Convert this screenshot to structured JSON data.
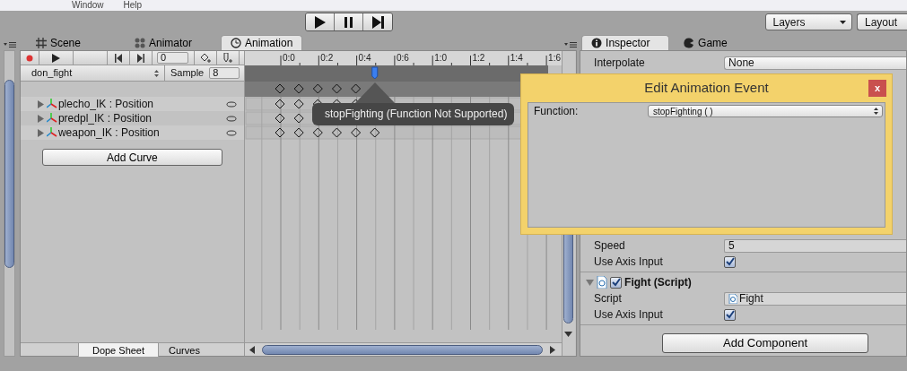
{
  "menu": [
    {
      "label": "Window"
    },
    {
      "label": "Help"
    }
  ],
  "toolbar": {
    "layers": "Layers",
    "layout": "Layout"
  },
  "left_tabs": [
    {
      "label": "Scene",
      "selected": false
    },
    {
      "label": "Animator",
      "selected": false
    },
    {
      "label": "Animation",
      "selected": true
    }
  ],
  "animation": {
    "recording": false,
    "frame": "0",
    "clip": "don_fight",
    "sample_label": "Sample",
    "sample": "8",
    "ruler": [
      "0:0",
      "0:2",
      "0:4",
      "0:6",
      "1:0",
      "1:2",
      "1:4",
      "1:6"
    ],
    "tracks": [
      {
        "name": "plecho_IK : Position",
        "expanded": false
      },
      {
        "name": "predpl_IK : Position",
        "expanded": false
      },
      {
        "name": "weapon_IK : Position",
        "expanded": false
      }
    ],
    "add_curve": "Add Curve",
    "view_tabs": [
      {
        "label": "Dope Sheet",
        "selected": true
      },
      {
        "label": "Curves",
        "selected": false
      }
    ],
    "tooltip": "stopFighting (Function Not Supported)"
  },
  "right_tabs": [
    {
      "label": "Inspector",
      "selected": true
    },
    {
      "label": "Game",
      "selected": false
    }
  ],
  "inspector": {
    "rows": [
      {
        "kind": "dropdown",
        "label": "Interpolate",
        "value": "None"
      },
      {
        "kind": "gap"
      },
      {
        "kind": "text",
        "label": "Speed",
        "value": "5"
      },
      {
        "kind": "checkbox",
        "label": "Use Axis Input",
        "checked": true
      }
    ],
    "component": {
      "title": "Fight (Script)",
      "enabled": true,
      "expanded": true,
      "rows": [
        {
          "kind": "object",
          "label": "Script",
          "value": "Fight"
        },
        {
          "kind": "checkbox",
          "label": "Use Axis Input",
          "checked": true
        }
      ]
    },
    "add_component": "Add Component"
  },
  "dialog": {
    "title": "Edit Animation Event",
    "close": "x",
    "function_label": "Function:",
    "function": "stopFighting ( )"
  }
}
